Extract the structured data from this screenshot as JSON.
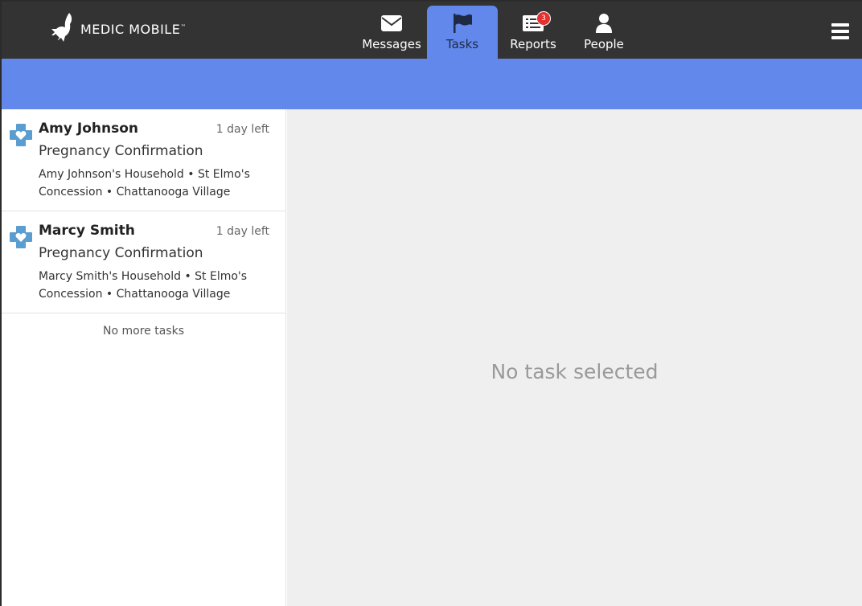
{
  "brand": {
    "name": "MEDIC MOBILE",
    "tm": "™"
  },
  "nav": {
    "tabs": [
      {
        "label": "Messages",
        "icon": "envelope-icon",
        "active": false
      },
      {
        "label": "Tasks",
        "icon": "flag-icon",
        "active": true
      },
      {
        "label": "Reports",
        "icon": "report-list-icon",
        "active": false,
        "badge": "3"
      },
      {
        "label": "People",
        "icon": "person-icon",
        "active": false
      }
    ],
    "menu_icon": "hamburger-menu-icon"
  },
  "tasks": [
    {
      "name": "Amy Johnson",
      "due": "1 day left",
      "title": "Pregnancy Confirmation",
      "place_line1": "Amy Johnson's Household • St Elmo's",
      "place_line2": "Concession • Chattanooga Village",
      "icon": "pregnancy-cross-heart-icon"
    },
    {
      "name": "Marcy Smith",
      "due": "1 day left",
      "title": "Pregnancy Confirmation",
      "place_line1": "Marcy Smith's Household • St Elmo's",
      "place_line2": "Concession • Chattanooga Village",
      "icon": "pregnancy-cross-heart-icon"
    }
  ],
  "no_more_tasks": "No more tasks",
  "detail": {
    "empty_message": "No task selected"
  },
  "colors": {
    "header_bg": "#333333",
    "accent_blue": "#6388ec",
    "badge_red": "#e33030",
    "task_icon_blue": "#5a9dd1"
  }
}
